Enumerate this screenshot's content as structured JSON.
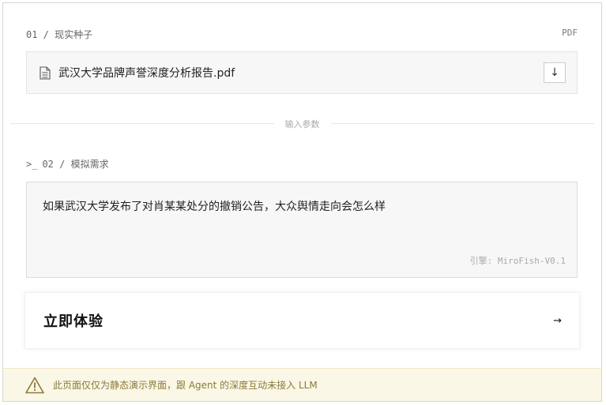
{
  "section1": {
    "label": "01 / 现实种子",
    "file_type": "PDF"
  },
  "file": {
    "name": "武汉大学品牌声誉深度分析报告.pdf",
    "download_icon": "↓"
  },
  "divider": {
    "label": "输入参数"
  },
  "section2": {
    "prefix": ">_",
    "label": "02 / 模拟需求"
  },
  "prompt": {
    "text": "如果武汉大学发布了对肖某某处分的撤销公告，大众舆情走向会怎么样",
    "engine": "引擎: MiroFish-V0.1"
  },
  "cta": {
    "label": "立即体验",
    "arrow": "→"
  },
  "notice": {
    "text": "此页面仅仅为静态演示界面，跟 Agent 的深度互动未接入 LLM"
  },
  "colors": {
    "notice_bg": "#fbf7e6",
    "notice_text": "#8a7a3a",
    "box_bg": "#f7f7f7"
  }
}
